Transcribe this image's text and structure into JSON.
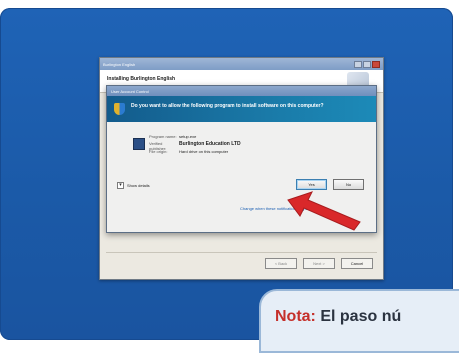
{
  "installer": {
    "title": "Burlington English",
    "heading": "Installing Burlington English",
    "buttons": [
      "< Back",
      "Next >",
      "Cancel"
    ]
  },
  "dialog": {
    "title": "User Account Control",
    "message": "Do you want to allow the following program to install software on this computer?",
    "details": {
      "program_name_label": "Program name:",
      "program_name_value": "setup.exe",
      "publisher_label": "Verified publisher:",
      "publisher_value": "Burlington Education LTD",
      "origin_label": "File origin:",
      "origin_value": "Hard drive on this computer"
    },
    "show_details": "Show details",
    "yes_label": "Yes",
    "no_label": "No",
    "change_link": "Change when these notifications appear"
  },
  "note": {
    "label": "Nota:",
    "text": "El paso nú"
  },
  "colors": {
    "screen_blue": "#1f63b6",
    "arrow_red": "#d9282a",
    "note_label_red": "#c5302b"
  }
}
